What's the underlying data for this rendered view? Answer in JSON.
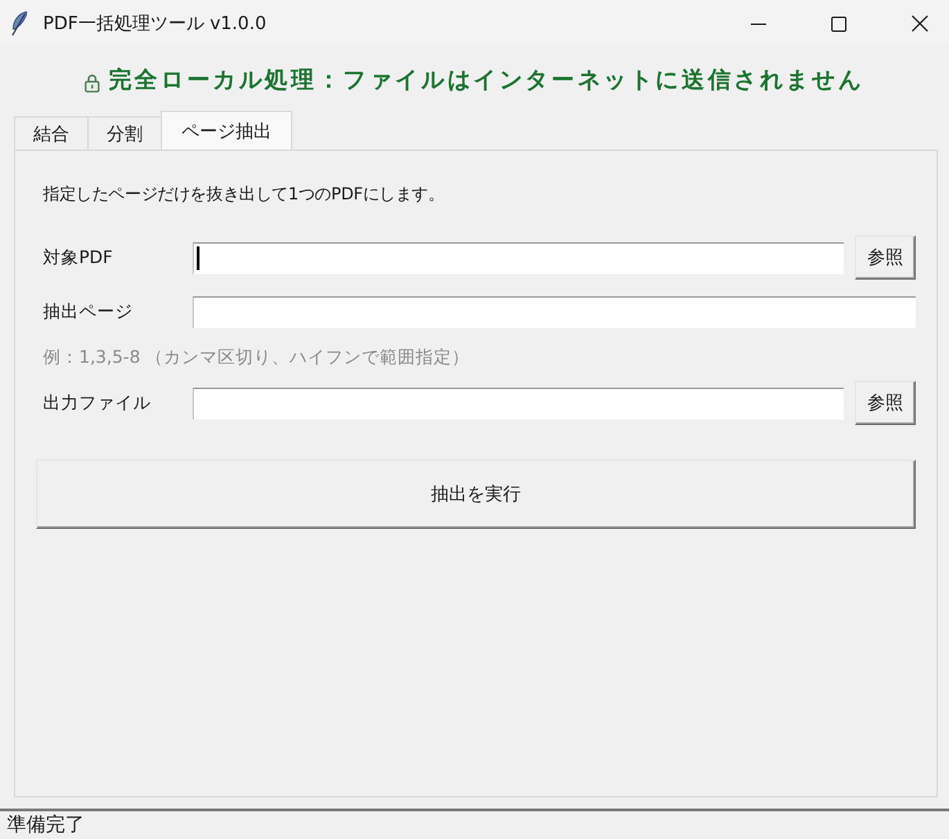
{
  "window": {
    "title": "PDF一括処理ツール v1.0.0"
  },
  "banner": {
    "text": "完全ローカル処理：ファイルはインターネットに送信されません"
  },
  "tabs": [
    {
      "label": "結合",
      "selected": false
    },
    {
      "label": "分割",
      "selected": false
    },
    {
      "label": "ページ抽出",
      "selected": true
    }
  ],
  "panel": {
    "description": "指定したページだけを抜き出して1つのPDFにします。",
    "rows": [
      {
        "kind": "file",
        "label": "対象PDF",
        "focused": true,
        "button": "参照"
      },
      {
        "kind": "text",
        "label": "抽出ページ",
        "focused": false
      },
      {
        "kind": "hint",
        "text": "例：1,3,5-8 （カンマ区切り、ハイフンで範囲指定）"
      },
      {
        "kind": "file",
        "label": "出力ファイル",
        "focused": false,
        "button": "参照"
      }
    ],
    "action_button": "抽出を実行"
  },
  "status_bar": {
    "text": "準備完了"
  }
}
